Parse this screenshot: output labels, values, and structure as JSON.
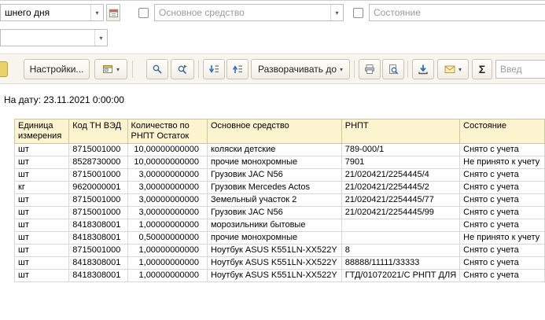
{
  "icons": {
    "dropdown": "▾",
    "sigma": "Σ"
  },
  "filters": {
    "period": {
      "value": "шнего дня"
    },
    "period2": {
      "value": ""
    },
    "asset": {
      "placeholder": "Основное средство",
      "checked": false
    },
    "state": {
      "placeholder": "Состояние",
      "checked": false
    }
  },
  "toolbar": {
    "settings_label": "Настройки...",
    "expand_to_label": "Разворачивать до",
    "search_placeholder": "Введ"
  },
  "report": {
    "as_of": "На дату: 23.11.2021 0:00:00"
  },
  "table": {
    "columns": [
      "Единица измерения",
      "Код ТН ВЭД",
      "Количество по РНПТ Остаток",
      "Основное средство",
      "РНПТ",
      "Состояние"
    ],
    "rows": [
      {
        "unit": "шт",
        "code": "8715001000",
        "qty": "10,00000000000",
        "asset": "коляски детские",
        "rnpt": "789-000/1",
        "state": "Снято с учета"
      },
      {
        "unit": "шт",
        "code": "8528730000",
        "qty": "10,00000000000",
        "asset": "прочие монохромные",
        "rnpt": "7901",
        "state": "Не принято к учету"
      },
      {
        "unit": "шт",
        "code": "8715001000",
        "qty": "3,00000000000",
        "asset": "Грузовик JAC N56",
        "rnpt": "21/020421/2254445/4",
        "state": "Снято с учета"
      },
      {
        "unit": "кг",
        "code": "9620000001",
        "qty": "3,00000000000",
        "asset": "Грузовик Mercedes Actos",
        "rnpt": "21/020421/2254445/2",
        "state": "Снято с учета"
      },
      {
        "unit": "шт",
        "code": "8715001000",
        "qty": "3,00000000000",
        "asset": "Земельный участок 2",
        "rnpt": "21/020421/2254445/77",
        "state": "Снято с учета"
      },
      {
        "unit": "шт",
        "code": "8715001000",
        "qty": "3,00000000000",
        "asset": "Грузовик JAC N56",
        "rnpt": "21/020421/2254445/99",
        "state": "Снято с учета"
      },
      {
        "unit": "шт",
        "code": "8418308001",
        "qty": "1,00000000000",
        "asset": "морозильники бытовые",
        "rnpt": "",
        "state": "Снято с учета"
      },
      {
        "unit": "шт",
        "code": "8418308001",
        "qty": "0,50000000000",
        "asset": "прочие монохромные",
        "rnpt": "",
        "state": "Не принято к учету"
      },
      {
        "unit": "шт",
        "code": "8715001000",
        "qty": "1,00000000000",
        "asset": "Ноутбук ASUS K551LN-XX522Y",
        "rnpt": "8",
        "state": "Снято с учета"
      },
      {
        "unit": "шт",
        "code": "8418308001",
        "qty": "1,00000000000",
        "asset": "Ноутбук ASUS K551LN-XX522Y",
        "rnpt": "88888/11111/33333",
        "state": "Снято с учета"
      },
      {
        "unit": "шт",
        "code": "8418308001",
        "qty": "1,00000000000",
        "asset": "Ноутбук ASUS K551LN-XX522Y",
        "rnpt": "ГТД/01072021/С РНПТ ДЛЯ",
        "state": "Снято с учета"
      }
    ]
  }
}
